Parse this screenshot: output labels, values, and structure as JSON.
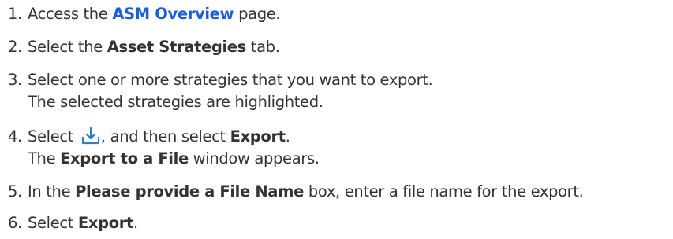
{
  "steps": [
    {
      "num": "1.",
      "pre": "Access the ",
      "link": "ASM Overview",
      "post": " page."
    },
    {
      "num": "2.",
      "pre": "Select the ",
      "bold": "Asset Strategies",
      "post": " tab."
    },
    {
      "num": "3.",
      "text": "Select one or more strategies that you want to export.",
      "result": "The selected strategies are highlighted."
    },
    {
      "num": "4.",
      "pre": "Select ",
      "icon": "download-icon",
      "mid": ", and then select ",
      "bold": "Export",
      "post": ".",
      "result_pre": "The ",
      "result_bold": "Export to a File",
      "result_post": " window appears."
    },
    {
      "num": "5.",
      "pre": "In the ",
      "bold": "Please provide a File Name",
      "post": " box, enter a file name for the export."
    },
    {
      "num": "6.",
      "pre": "Select ",
      "bold": "Export",
      "post": "."
    }
  ],
  "colors": {
    "text": "#333333",
    "link": "#1a5fd8",
    "icon": "#2f7fc1"
  }
}
